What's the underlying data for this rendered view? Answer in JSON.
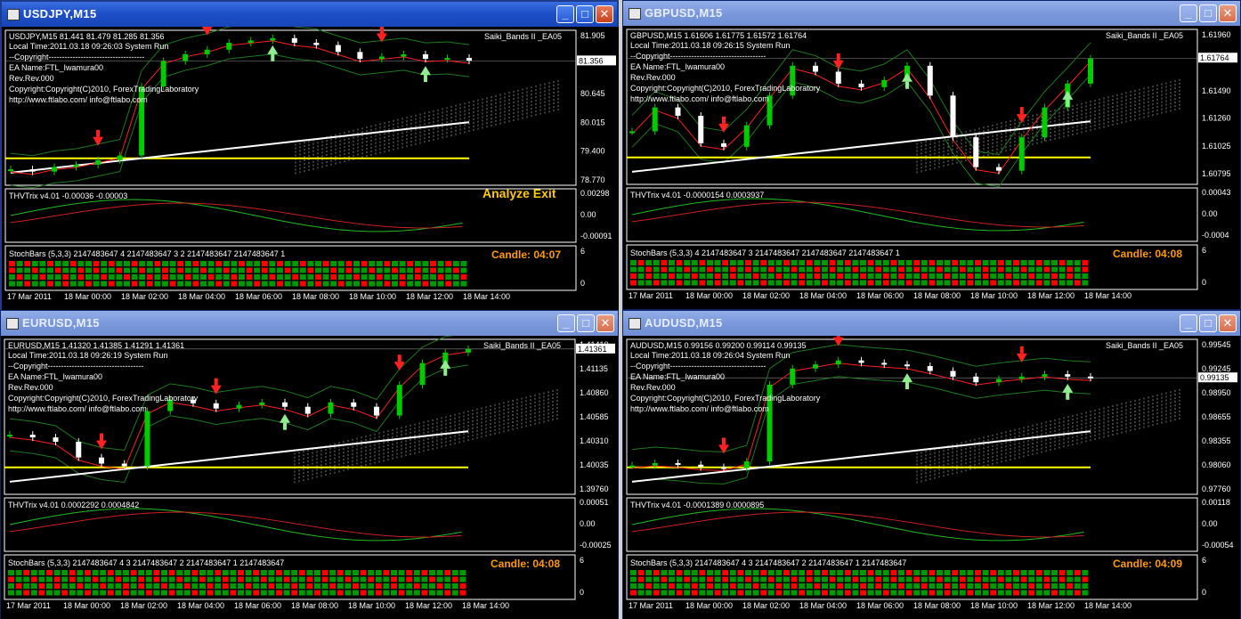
{
  "windows": [
    {
      "id": "usdjpy",
      "title": "USDJPY,M15",
      "active": true,
      "info_line": "USDJPY,M15  81.441 81.479 81.285 81.356",
      "local_time": "Local Time:2011.03.18 09:26:03 System Run",
      "ea_label": "Saiki_Bands II _EA05",
      "price_ticks": [
        "81.905",
        "81.356",
        "80.645",
        "80.015",
        "79.400",
        "78.770"
      ],
      "current_price": "81.356",
      "thv_label": "THVTrix v4.01 -0.00036 -0.00003",
      "thv_ticks": [
        "0.00298",
        "0.00",
        "-0.00091"
      ],
      "stoch_label": "StochBars (5,3,3) 2147483647 4 2147483647 3 2 2147483647 2147483647 1",
      "stoch_ticks": [
        "6",
        "0"
      ],
      "candle_timer": "Candle:  04:07",
      "extra_label": "Analyze Exit",
      "time_labels": [
        "17 Mar 2011",
        "18 Mar 00:00",
        "18 Mar 02:00",
        "18 Mar 04:00",
        "18 Mar 06:00",
        "18 Mar 08:00",
        "18 Mar 10:00",
        "18 Mar 12:00",
        "18 Mar 14:00"
      ]
    },
    {
      "id": "gbpusd",
      "title": "GBPUSD,M15",
      "active": false,
      "info_line": "GBPUSD,M15  1.61606 1.61775 1.61572 1.61764",
      "local_time": "Local Time:2011.03.18 09:26:15 System Run",
      "ea_label": "Saiki_Bands II _EA05",
      "price_ticks": [
        "1.61960",
        "1.61764",
        "1.61490",
        "1.61260",
        "1.61025",
        "1.60795"
      ],
      "current_price": "1.61764",
      "thv_label": "THVTrix v4.01 -0.0000154 0.0003937",
      "thv_ticks": [
        "0.00043",
        "0.00",
        "-0.0004"
      ],
      "stoch_label": "StochBars (5,3,3) 4 2147483647 3 2147483647 2147483647 2147483647 1",
      "stoch_ticks": [
        "6",
        "0"
      ],
      "candle_timer": "Candle:  04:08",
      "extra_label": "",
      "time_labels": [
        "17 Mar 2011",
        "18 Mar 00:00",
        "18 Mar 02:00",
        "18 Mar 04:00",
        "18 Mar 06:00",
        "18 Mar 08:00",
        "18 Mar 10:00",
        "18 Mar 12:00",
        "18 Mar 14:00"
      ]
    },
    {
      "id": "eurusd",
      "title": "EURUSD,M15",
      "active": false,
      "info_line": "EURUSD,M15  1.41320 1.41385 1.41291 1.41361",
      "local_time": "Local Time:2011.03.18 09:26:19 System Run",
      "ea_label": "Saiki_Bands II _EA05",
      "price_ticks": [
        "1.41410",
        "1.41361",
        "1.41135",
        "1.40860",
        "1.40585",
        "1.40310",
        "1.40035",
        "1.39760"
      ],
      "current_price": "1.41361",
      "thv_label": "THVTrix v4.01 0.0002292 0.0004842",
      "thv_ticks": [
        "0.00051",
        "0.00",
        "-0.00025"
      ],
      "stoch_label": "StochBars (5,3,3) 2147483647 4 3 2147483647 2 2147483647 1 2147483647",
      "stoch_ticks": [
        "6",
        "0"
      ],
      "candle_timer": "Candle:  04:08",
      "extra_label": "",
      "time_labels": [
        "17 Mar 2011",
        "18 Mar 00:00",
        "18 Mar 02:00",
        "18 Mar 04:00",
        "18 Mar 06:00",
        "18 Mar 08:00",
        "18 Mar 10:00",
        "18 Mar 12:00",
        "18 Mar 14:00"
      ]
    },
    {
      "id": "audusd",
      "title": "AUDUSD,M15",
      "active": false,
      "info_line": "AUDUSD,M15  0.99156 0.99200 0.99114 0.99135",
      "local_time": "Local Time:2011.03.18 09:26:04 System Run",
      "ea_label": "Saiki_Bands II _EA05",
      "price_ticks": [
        "0.99545",
        "0.99245",
        "0.99135",
        "0.98950",
        "0.98655",
        "0.98355",
        "0.98060",
        "0.97760"
      ],
      "current_price": "0.99135",
      "thv_label": "THVTrix v4.01 -0.0001389 0.0000895",
      "thv_ticks": [
        "0.00118",
        "0.00",
        "-0.00054"
      ],
      "stoch_label": "StochBars (5,3,3) 2147483647 4 3 2147483647 2 2147483647 1 2147483647",
      "stoch_ticks": [
        "6",
        "0"
      ],
      "candle_timer": "Candle:  04:09",
      "extra_label": "",
      "time_labels": [
        "17 Mar 2011",
        "18 Mar 00:00",
        "18 Mar 02:00",
        "18 Mar 04:00",
        "18 Mar 06:00",
        "18 Mar 08:00",
        "18 Mar 10:00",
        "18 Mar 12:00",
        "18 Mar 14:00"
      ]
    }
  ],
  "common": {
    "copyright": "--Copyright------------------------------------",
    "ea_name": "EA Name:FTL_Iwamura00",
    "rev": "Rev.Rev.000",
    "copyright_line": "Copyright:Copyright(C)2010, ForexTradingLaboratory",
    "site": "http://www.ftlabo.com/ info@ftlabo.com"
  },
  "colors": {
    "bull": "#00cc00",
    "bear": "#ffffff",
    "up_arrow": "#90ee90",
    "down_arrow": "#ff2020",
    "down_arrow_light": "#ffb6c1",
    "ma_white": "#ffffff",
    "ma_yellow": "#ffff00",
    "ma_red": "#ff2020",
    "band_green": "#1e7a1e",
    "thv_green": "#22bb22",
    "thv_red": "#cc2020",
    "stoch_green": "#009900",
    "stoch_red": "#ff0000"
  },
  "chart_data": [
    {
      "type": "line",
      "title": "USDJPY,M15",
      "ylim": [
        78.77,
        81.905
      ],
      "y_ticks": [
        81.905,
        81.356,
        80.645,
        80.015,
        79.4,
        78.77
      ],
      "close_price": 81.356,
      "series": [
        {
          "values": [
            79.0,
            78.95,
            79.05,
            79.1,
            79.2,
            79.3,
            80.8,
            81.35,
            81.5,
            81.6,
            81.75,
            81.8,
            81.85,
            81.75,
            81.7,
            81.55,
            81.4,
            81.45,
            81.5,
            81.4,
            81.42,
            81.36
          ]
        }
      ]
    },
    {
      "type": "line",
      "title": "GBPUSD,M15",
      "ylim": [
        1.6075,
        1.6196
      ],
      "y_ticks": [
        1.6196,
        1.61764,
        1.6149,
        1.6126,
        1.61025,
        1.60795
      ],
      "close_price": 1.61764,
      "series": [
        {
          "values": [
            1.6115,
            1.6135,
            1.6128,
            1.6105,
            1.6102,
            1.612,
            1.6145,
            1.617,
            1.6165,
            1.6155,
            1.6152,
            1.6158,
            1.617,
            1.6145,
            1.611,
            1.6085,
            1.6082,
            1.611,
            1.6135,
            1.6155,
            1.6176
          ]
        }
      ]
    },
    {
      "type": "line",
      "title": "EURUSD,M15",
      "ylim": [
        1.3976,
        1.4141
      ],
      "y_ticks": [
        1.4141,
        1.41361,
        1.41135,
        1.4086,
        1.40585,
        1.4031,
        1.40035,
        1.3976
      ],
      "close_price": 1.41361,
      "series": [
        {
          "values": [
            1.4038,
            1.4035,
            1.403,
            1.4012,
            1.4005,
            1.4002,
            1.4065,
            1.4078,
            1.4074,
            1.4068,
            1.4072,
            1.4075,
            1.407,
            1.4062,
            1.4075,
            1.407,
            1.406,
            1.4095,
            1.412,
            1.4132,
            1.4136
          ]
        }
      ]
    },
    {
      "type": "line",
      "title": "AUDUSD,M15",
      "ylim": [
        0.9776,
        0.99545
      ],
      "y_ticks": [
        0.99545,
        0.99245,
        0.99135,
        0.9895,
        0.98655,
        0.98355,
        0.9806,
        0.9776
      ],
      "close_price": 0.99135,
      "series": [
        {
          "values": [
            0.9805,
            0.9808,
            0.9806,
            0.9803,
            0.9802,
            0.981,
            0.9905,
            0.9925,
            0.993,
            0.9935,
            0.9932,
            0.993,
            0.9928,
            0.9922,
            0.9915,
            0.9908,
            0.9912,
            0.9915,
            0.9918,
            0.9915,
            0.99135
          ]
        }
      ]
    }
  ]
}
